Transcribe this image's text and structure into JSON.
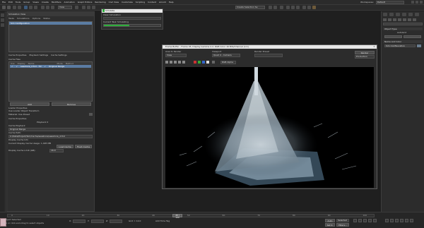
{
  "app": {
    "menus": [
      "File",
      "Edit",
      "Tools",
      "Group",
      "Views",
      "Create",
      "Modifiers",
      "Animation",
      "Graph Editors",
      "Rendering",
      "Civil View",
      "Customize",
      "Scripting",
      "Content",
      "Arnold",
      "Help"
    ],
    "workspace_label": "Workspaces:",
    "workspace_value": "Default",
    "selection_set": "Create Selection Se",
    "view_dropdown": "View"
  },
  "left_panel": {
    "title": "Simulation View",
    "tabs": [
      "Tasks",
      "Simulations",
      "Options",
      "Status"
    ],
    "selected_item": "Sim Configuration",
    "cache_tabs": [
      "Cache Properties",
      "Playback Settings",
      "Cache Settings"
    ],
    "cache_list_label": "Cache Files",
    "cache_columns": [
      "Use",
      "Display",
      "Name",
      "Mode",
      "Method"
    ],
    "cache_row": {
      "use": "✓",
      "display": "✓",
      "name": "seashore_2.fxd - 50",
      "mode": "✓",
      "method": "Original Range"
    },
    "buttons": {
      "add": "Add",
      "remove": "Remove"
    },
    "sections": {
      "loader": "Loader Properties",
      "use_loader_transform": "Use Loader Object Transform",
      "materials_label": "Material: Use Preset",
      "cache_properties": "Cache Properties",
      "playback_label": "Playback 0",
      "cache_playback": "Cache Playback",
      "playback_mode": "Original Range",
      "cache_path_label": "Cache Path:",
      "cache_path": "C:/Data/Project/Sim/Cache/seashore/seashore_2.fxd",
      "display_cache_info": "Display Cache Info",
      "current_display": "Current Display Cache Usage: 1,495 MB",
      "load_cache": "Load Cache",
      "flush_cache": "Flush Cache",
      "display_cache_limit": "Display Cache Limit (GB):",
      "display_cache_limit_value": "16.0"
    }
  },
  "small_dialog": {
    "title": "Simulate",
    "row1": "Clear Simulation",
    "row2_label": "Current Task",
    "row2_value": "Simulating",
    "progress_pct": 0.45
  },
  "vfw": {
    "title": "Frame Buffer - Frame 45, Display Gamma 2.2, RGB Color 16 Bits/Channel (1:1)",
    "area_label": "Area to Render",
    "area_value": "View",
    "viewport_label": "Viewport",
    "viewport_value": "Quad 4 - Camera",
    "preset_label": "Render Preset",
    "preset_value": "",
    "render_button": "Render",
    "production": "Production",
    "channel_value": "RGB Alpha"
  },
  "command_panel": {
    "object_type": "Object Type",
    "autogrid": "AutoGrid",
    "name_and_color": "Name and Color",
    "object_name": "Sim Configuration"
  },
  "bottom": {
    "status1": "1 Object Selected",
    "status2": "Click or click-and-drag to select objects",
    "frame_counter": "45 / 100",
    "timeline_ticks": [
      "0",
      "10",
      "20",
      "30",
      "40",
      "50",
      "60",
      "70",
      "80",
      "90",
      "100"
    ],
    "coord_x": "X:",
    "coord_y": "Y:",
    "coord_z": "Z:",
    "grid": "Grid = 10.0",
    "add_time_tag": "Add Time Tag",
    "auto": "Auto",
    "selected": "Selected",
    "set_key": "Set K.",
    "filters": "Filters..."
  },
  "colors": {
    "bg": "#1f1f1f",
    "panel": "#2e2e2e",
    "accent": "#5b7ca3",
    "progress": "#2fae3b",
    "viewport": "#000000"
  }
}
